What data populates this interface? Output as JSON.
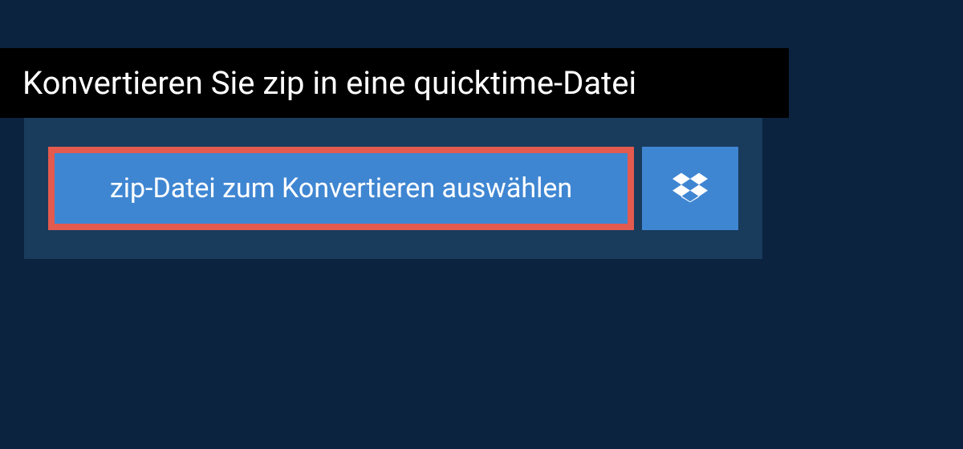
{
  "header": {
    "title": "Konvertieren Sie zip in eine quicktime-Datei"
  },
  "panel": {
    "select_file_label": "zip-Datei zum Konvertieren auswählen"
  }
}
